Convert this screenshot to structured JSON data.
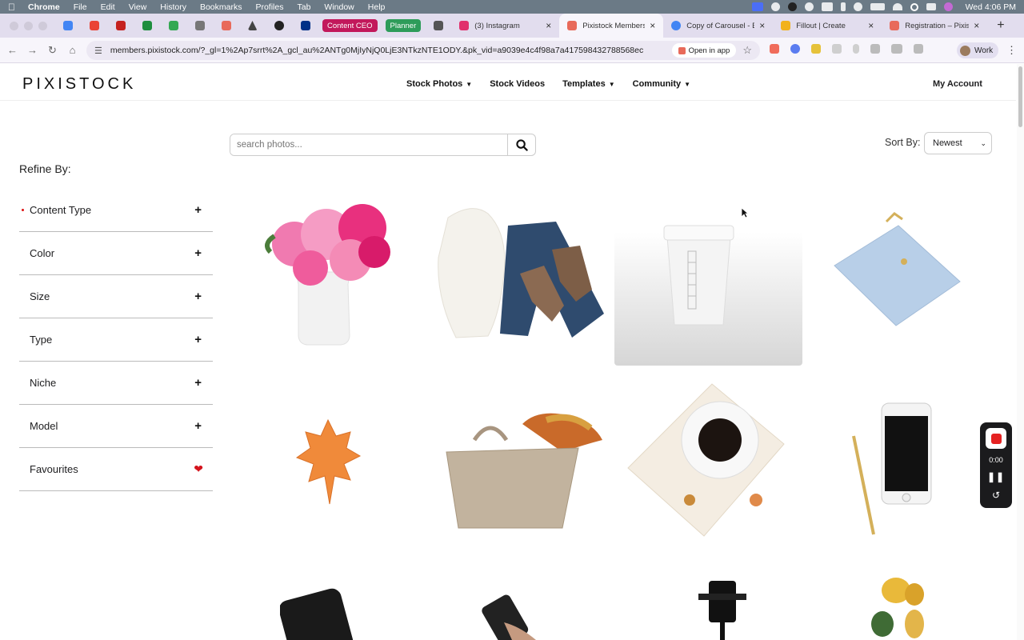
{
  "menubar": {
    "app": "Chrome",
    "items": [
      "File",
      "Edit",
      "View",
      "History",
      "Bookmarks",
      "Profiles",
      "Tab",
      "Window",
      "Help"
    ],
    "clock": "Wed 4:06 PM"
  },
  "tabs": {
    "pinned_badges": [
      {
        "label": "Content CEO",
        "color": "#c2185b"
      },
      {
        "label": "Planner",
        "color": "#2e9c5a"
      }
    ],
    "items": [
      {
        "title": "(3) Instagram",
        "fav_color": "#e1306c",
        "active": false
      },
      {
        "title": "Pixistock Members -",
        "fav_color": "#e86a5a",
        "active": true
      },
      {
        "title": "Copy of Carousel - B",
        "fav_color": "#4285f4",
        "active": false
      },
      {
        "title": "Fillout | Create",
        "fav_color": "#f2b21c",
        "active": false
      },
      {
        "title": "Registration – Pixisto",
        "fav_color": "#e86a5a",
        "active": false
      }
    ]
  },
  "toolbar": {
    "url": "members.pixistock.com/?_gl=1%2Ap7srrt%2A_gcl_au%2ANTg0MjIyNjQ0LjE3NTkzNTE1ODY.&pk_vid=a9039e4c4f98a7a417598432788568ec",
    "open_in_app": "Open in app",
    "profile": "Work"
  },
  "site": {
    "logo": "PIXISTOCK",
    "nav": [
      {
        "label": "Stock Photos",
        "dropdown": true
      },
      {
        "label": "Stock Videos",
        "dropdown": false
      },
      {
        "label": "Templates",
        "dropdown": true
      },
      {
        "label": "Community",
        "dropdown": true
      }
    ],
    "account": "My Account"
  },
  "search": {
    "placeholder": "search photos..."
  },
  "sort": {
    "label": "Sort By:",
    "selected": "Newest"
  },
  "refine": {
    "title": "Refine By:",
    "filters": [
      "Content Type",
      "Color",
      "Size",
      "Type",
      "Niche",
      "Model",
      "Favourites"
    ]
  },
  "recorder": {
    "time": "0:00"
  }
}
